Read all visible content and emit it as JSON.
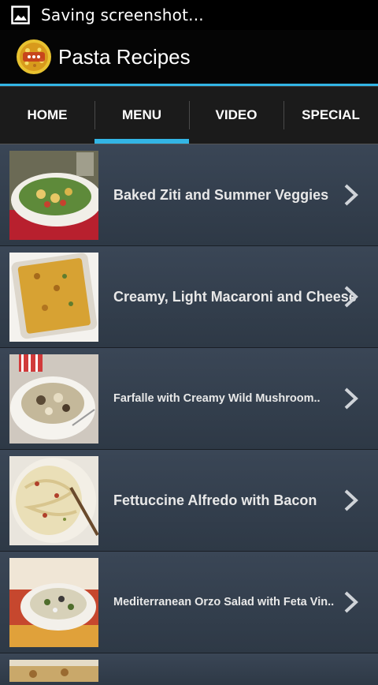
{
  "status_bar": {
    "notification_text": "Saving screenshot..."
  },
  "action_bar": {
    "title": "Pasta Recipes"
  },
  "tabs": [
    {
      "label": "HOME",
      "active": false
    },
    {
      "label": "MENU",
      "active": true
    },
    {
      "label": "VIDEO",
      "active": false
    },
    {
      "label": "SPECIAL",
      "active": false
    }
  ],
  "recipes": [
    {
      "title": "Baked Ziti and Summer Veggies"
    },
    {
      "title": "Creamy, Light Macaroni and Cheese"
    },
    {
      "title": "Farfalle with Creamy Wild Mushroom.."
    },
    {
      "title": "Fettuccine Alfredo with Bacon"
    },
    {
      "title": "Mediterranean Orzo Salad with Feta Vin.."
    }
  ],
  "colors": {
    "accent": "#33b5e5",
    "row_bg": "#3a4656"
  }
}
